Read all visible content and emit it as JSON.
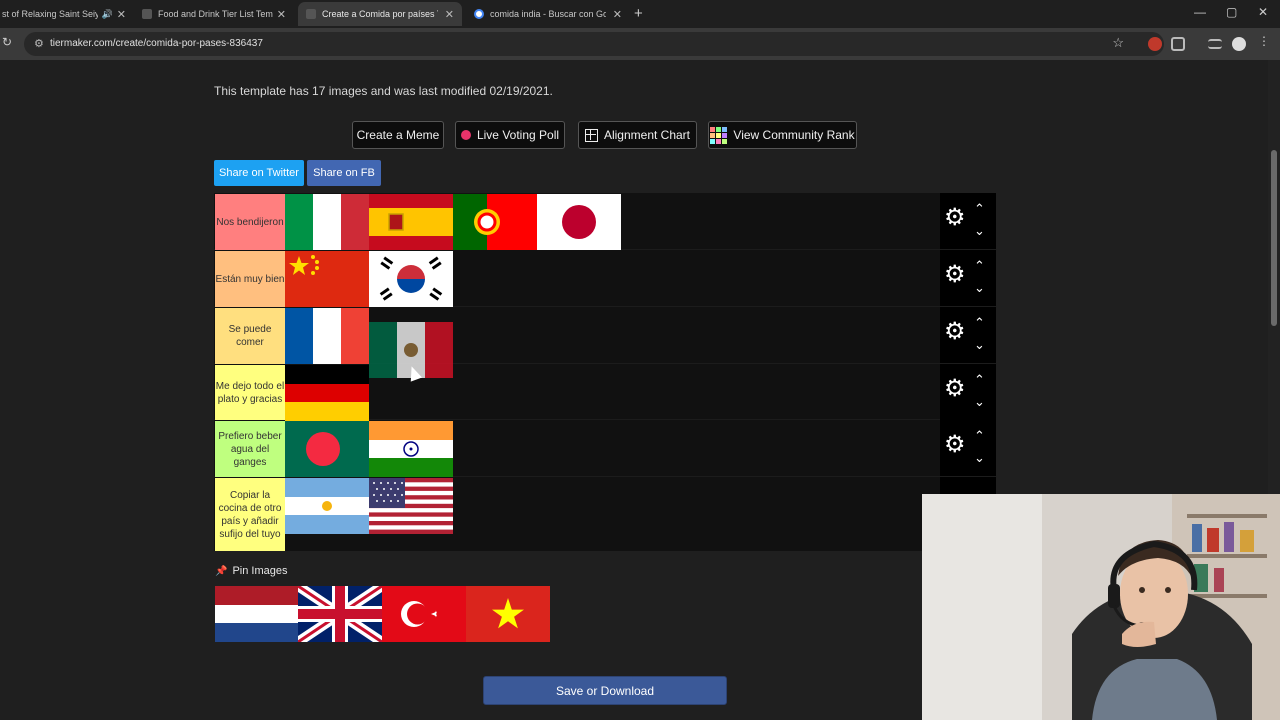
{
  "browser": {
    "tabs": [
      {
        "title": "st of Relaxing Saint Seiya",
        "fav_color": "#c0392b",
        "sound": true
      },
      {
        "title": "Food and Drink Tier List Templ",
        "fav_color": "#555555",
        "sound": false
      },
      {
        "title": "Create a Comida por países Tier",
        "fav_color": "#555555",
        "sound": false
      },
      {
        "title": "comida india - Buscar con Goo",
        "fav_color": "#4285f4",
        "sound": false
      }
    ],
    "close_glyph": "✕",
    "url": "tiermaker.com/create/comida-por-pases-836437"
  },
  "page": {
    "info_text": "This template has 17 images and was last modified 02/19/2021.",
    "buttons": {
      "create_meme": "Create a Meme",
      "live_voting": "Live Voting Poll",
      "alignment": "Alignment Chart",
      "community_rank": "View Community Rank"
    },
    "share": {
      "twitter": "Share on Twitter",
      "fb": "Share on FB"
    },
    "tiers": [
      {
        "label": "Nos bendijeron",
        "color": "#ff7f7f",
        "flags": [
          "italy",
          "spain",
          "portugal",
          "japan"
        ]
      },
      {
        "label": "Están muy bien",
        "color": "#ffbf7f",
        "flags": [
          "china",
          "south-korea"
        ]
      },
      {
        "label": "Se puede comer",
        "color": "#ffdf7f",
        "flags": [
          "france"
        ]
      },
      {
        "label": "Me dejo todo el plato y gracias",
        "color": "#ffff7f",
        "flags": [
          "germany"
        ]
      },
      {
        "label": "Prefiero beber agua del ganges",
        "color": "#bfff7f",
        "flags": [
          "bangladesh",
          "india"
        ]
      },
      {
        "label": "Copiar la cocina de otro país y añadir sufijo del tuyo",
        "color": "#ffff7f",
        "flags": [
          "argentina",
          "usa"
        ]
      }
    ],
    "dragging_flag": "mexico",
    "pin_images_label": "Pin Images",
    "pool_flags": [
      "netherlands",
      "uk",
      "turkey",
      "vietnam"
    ],
    "save_button": "Save or Download"
  }
}
